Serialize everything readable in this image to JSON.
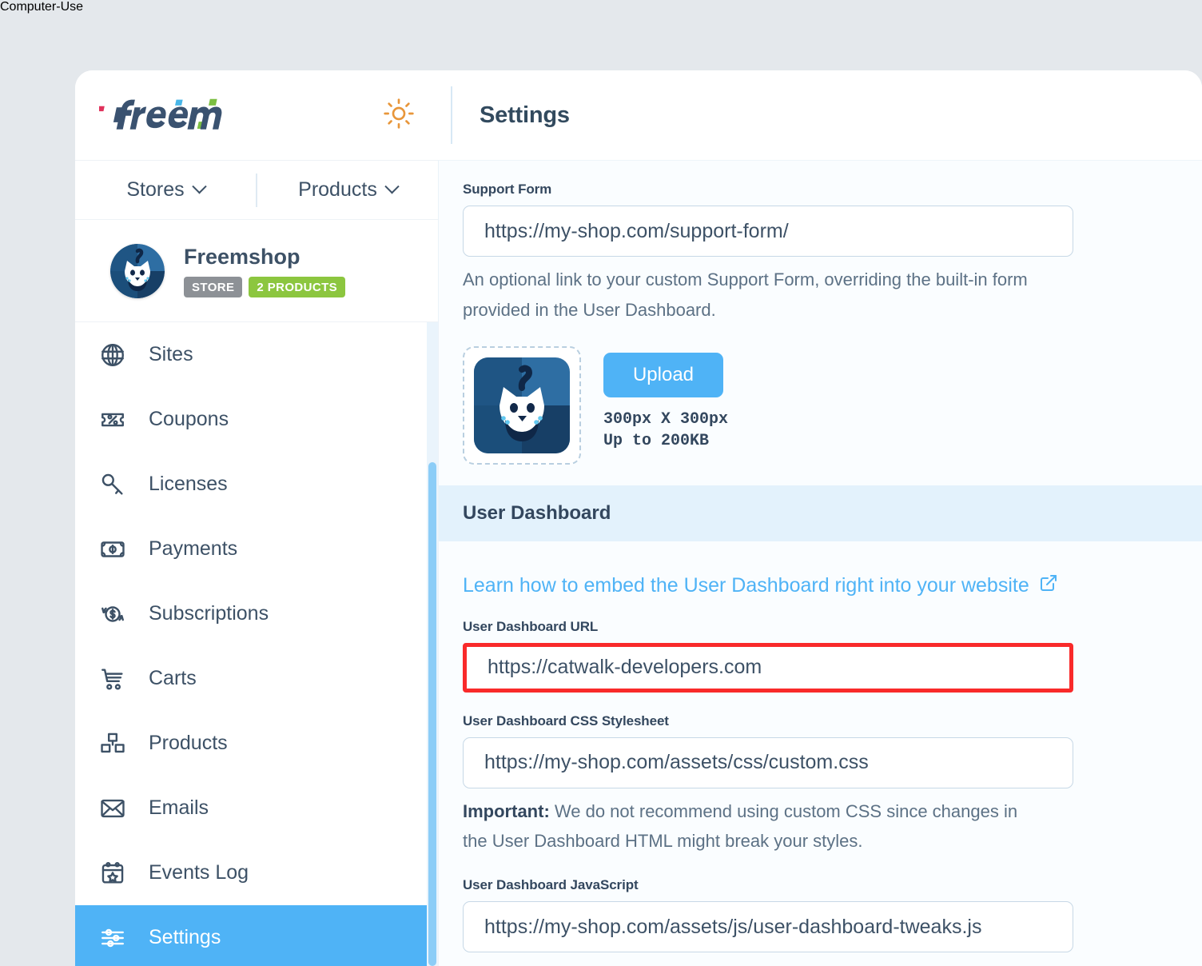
{
  "window": {
    "brand_logo_alt": "freemius",
    "page_title": "Settings"
  },
  "topbar": {
    "theme_toggle_name": "sun-icon"
  },
  "switcher": {
    "stores_label": "Stores",
    "products_label": "Products"
  },
  "store": {
    "name": "Freemshop",
    "badge_type": "STORE",
    "badge_products": "2 PRODUCTS"
  },
  "sidebar": {
    "items": [
      {
        "label": "Sites",
        "icon": "globe-icon",
        "active": false
      },
      {
        "label": "Coupons",
        "icon": "coupon-icon",
        "active": false
      },
      {
        "label": "Licenses",
        "icon": "key-icon",
        "active": false
      },
      {
        "label": "Payments",
        "icon": "banknote-icon",
        "active": false
      },
      {
        "label": "Subscriptions",
        "icon": "recurring-dollar-icon",
        "active": false
      },
      {
        "label": "Carts",
        "icon": "shopping-cart-icon",
        "active": false
      },
      {
        "label": "Products",
        "icon": "boxes-icon",
        "active": false
      },
      {
        "label": "Emails",
        "icon": "envelope-icon",
        "active": false
      },
      {
        "label": "Events Log",
        "icon": "calendar-star-icon",
        "active": false
      },
      {
        "label": "Settings",
        "icon": "sliders-icon",
        "active": true
      }
    ]
  },
  "main": {
    "support_form": {
      "label": "Support Form",
      "value": "https://my-shop.com/support-form/",
      "help": "An optional link to your custom Support Form, overriding the built-in form provided in the User Dashboard."
    },
    "upload": {
      "button_label": "Upload",
      "dimensions": "300px X 300px",
      "max_size": "Up to 200KB",
      "image_name": "store-logo-preview"
    },
    "user_dashboard_section": {
      "title": "User Dashboard",
      "learn_link": "Learn how to embed the User Dashboard right into your website",
      "url_field": {
        "label": "User Dashboard URL",
        "value": "https://catwalk-developers.com",
        "highlighted": true,
        "highlight_color": "#f92a2a"
      },
      "css_field": {
        "label": "User Dashboard CSS Stylesheet",
        "value": "https://my-shop.com/assets/css/custom.css",
        "help_bold": "Important:",
        "help": " We do not recommend using custom CSS since changes in the User Dashboard HTML might break your styles."
      },
      "js_field": {
        "label": "User Dashboard JavaScript",
        "value": "https://my-shop.com/assets/js/user-dashboard-tweaks.js"
      }
    }
  },
  "colors": {
    "accent": "#4fb3f6",
    "text": "#3d5166",
    "badge_green": "#8cc63f",
    "badge_gray": "#8d9196",
    "highlight_red": "#f92a2a",
    "band": "#e3f2fc"
  }
}
